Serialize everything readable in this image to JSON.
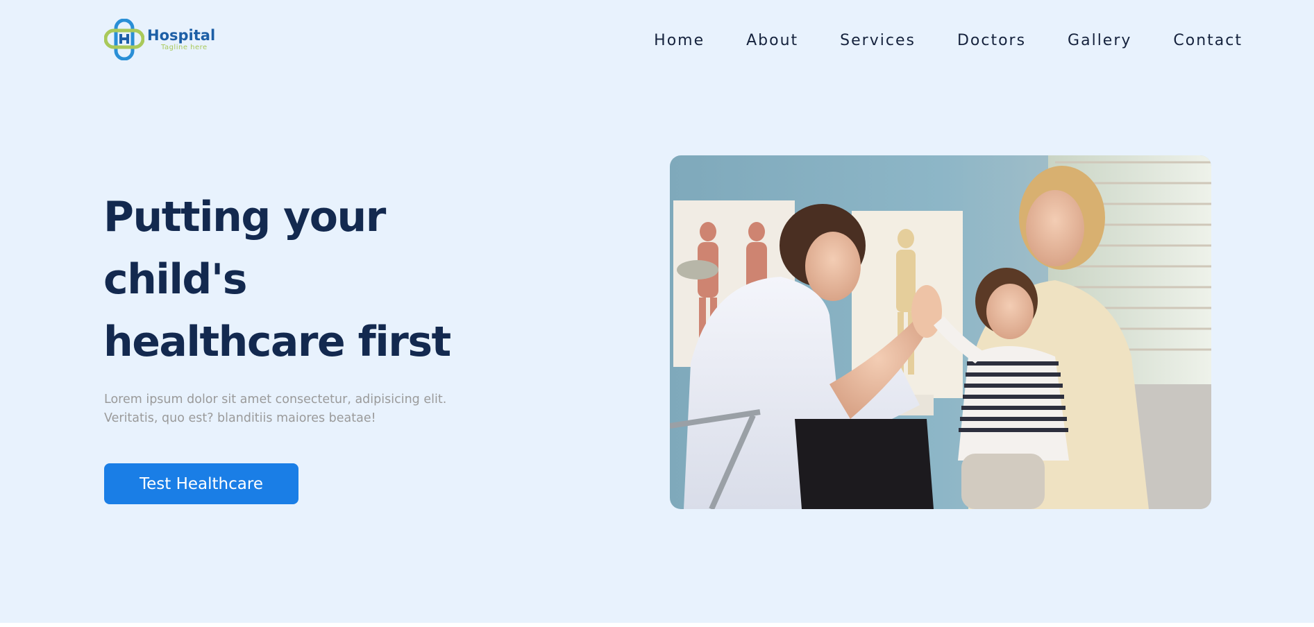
{
  "brand": {
    "name": "Hospital",
    "tagline": "Tagline here",
    "logo_icon": "medical-cross-logo",
    "colors": {
      "primary_dark": "#13294f",
      "accent_blue": "#1a7ee6",
      "logo_blue": "#1d5fa6",
      "logo_green": "#a9c95a",
      "background": "#e8f2fd"
    }
  },
  "nav": {
    "items": [
      "Home",
      "About",
      "Services",
      "Doctors",
      "Gallery",
      "Contact"
    ]
  },
  "hero": {
    "title_lines": [
      "Putting your",
      "child's",
      "healthcare first"
    ],
    "subtitle_lines": [
      "Lorem ipsum dolor sit amet consectetur, adipisicing elit.",
      "Veritatis, quo est? blanditiis maiores beatae!"
    ],
    "cta_label": "Test Healthcare",
    "image_icon": "doctor-child-high-five-photo"
  }
}
